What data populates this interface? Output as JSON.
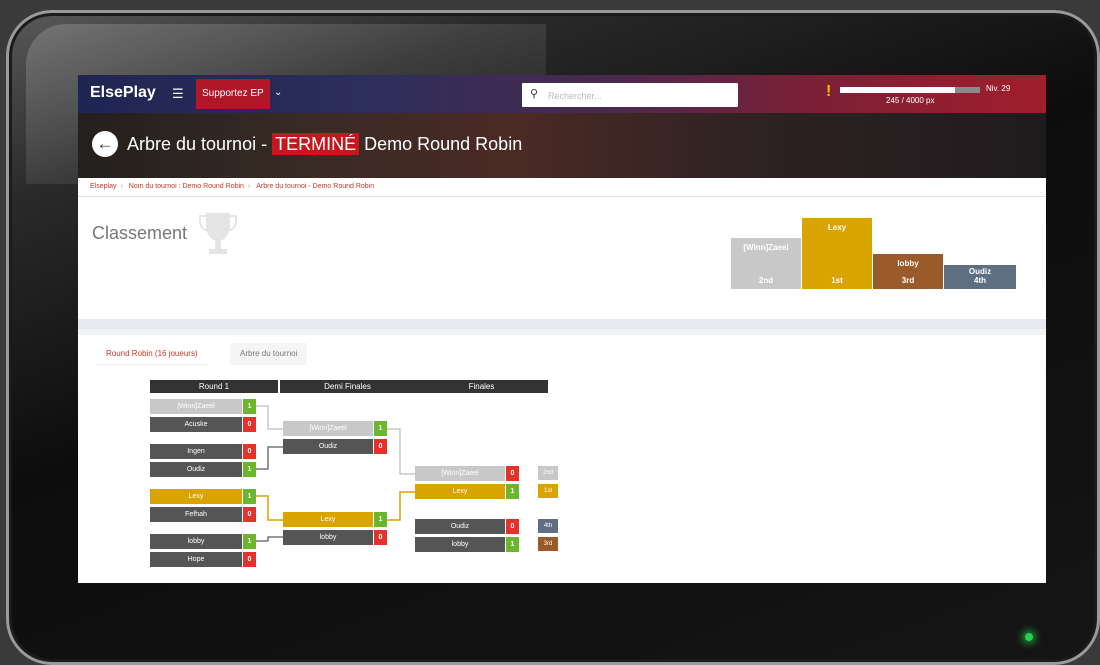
{
  "navbar": {
    "brand": "ElsePlay",
    "menu_icon": "hamburger-icon",
    "support_label": "Supportez EP",
    "dropdown_icon": "chevron-down-icon",
    "search_placeholder": "Rechercher...",
    "alert_icon": "exclamation-icon",
    "xp_text": "245 / 4000 px",
    "xp_progress": 0.82,
    "level": "Niv. 29"
  },
  "hero": {
    "title": "Arbre du tournoi -",
    "status": "TERMINÉ",
    "tournament": "Demo Round Robin"
  },
  "breadcrumb": [
    "Elseplay",
    "Nom du tournoi : Demo Round Robin",
    "Arbre du tournoi - Demo Round Robin"
  ],
  "ranking": {
    "title": "Classement",
    "podium": [
      {
        "name": "Lexy",
        "place": "1st",
        "color": "#d9a300"
      },
      {
        "name": "[Winn]Zaeel",
        "place": "2nd",
        "color": "#c8c8c8"
      },
      {
        "name": "lobby",
        "place": "3rd",
        "color": "#9b5a2a"
      },
      {
        "name": "Oudiz",
        "place": "4th",
        "color": "#5e6f82"
      }
    ]
  },
  "tabs": [
    {
      "label": "Round Robin (16 joueurs)",
      "active": true
    },
    {
      "label": "Arbre du tournoi",
      "active": false
    }
  ],
  "bracket": {
    "rounds": [
      "Round 1",
      "Demi Finales",
      "Finales"
    ],
    "round1": [
      [
        {
          "name": "[Winn]Zaeel",
          "score": "1",
          "win": true,
          "color": "#c8c8c8"
        },
        {
          "name": "Acuske",
          "score": "0",
          "win": false,
          "color": "#555"
        }
      ],
      [
        {
          "name": "Ingen",
          "score": "0",
          "win": false,
          "color": "#555"
        },
        {
          "name": "Oudiz",
          "score": "1",
          "win": true,
          "color": "#555"
        }
      ],
      [
        {
          "name": "Lexy",
          "score": "1",
          "win": true,
          "color": "#d9a300"
        },
        {
          "name": "Fefhah",
          "score": "0",
          "win": false,
          "color": "#555"
        }
      ],
      [
        {
          "name": "lobby",
          "score": "1",
          "win": true,
          "color": "#555"
        },
        {
          "name": "Hope",
          "score": "0",
          "win": false,
          "color": "#555"
        }
      ]
    ],
    "semis": [
      [
        {
          "name": "[Winn]Zaeel",
          "score": "1",
          "win": true,
          "color": "#c8c8c8"
        },
        {
          "name": "Oudiz",
          "score": "0",
          "win": false,
          "color": "#555"
        }
      ],
      [
        {
          "name": "Lexy",
          "score": "1",
          "win": true,
          "color": "#d9a300"
        },
        {
          "name": "lobby",
          "score": "0",
          "win": false,
          "color": "#555"
        }
      ]
    ],
    "finals": [
      [
        {
          "name": "[Winn]Zaeel",
          "score": "0",
          "win": false,
          "color": "#c8c8c8"
        },
        {
          "name": "Lexy",
          "score": "1",
          "win": true,
          "color": "#d9a300"
        }
      ],
      [
        {
          "name": "Oudiz",
          "score": "0",
          "win": false,
          "color": "#555"
        },
        {
          "name": "lobby",
          "score": "1",
          "win": true,
          "color": "#555"
        }
      ]
    ],
    "placements": [
      {
        "label": "2nd",
        "color": "#c8c8c8"
      },
      {
        "label": "1st",
        "color": "#d9a300"
      },
      {
        "label": "4th",
        "color": "#5e6f82"
      },
      {
        "label": "3rd",
        "color": "#9b5a2a"
      }
    ]
  },
  "colors": {
    "win": "#6bb52f",
    "loss": "#e2322b"
  }
}
